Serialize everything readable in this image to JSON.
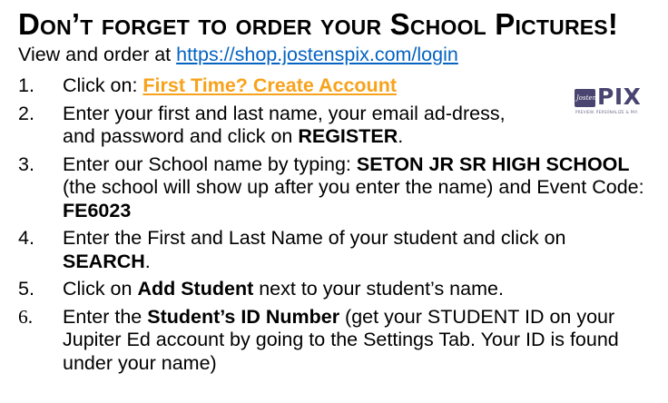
{
  "heading": "Don’t forget to order your School Pictures!",
  "subline": {
    "prefix": "View and order at ",
    "url": "https://shop.jostenspix.com/login"
  },
  "logo": {
    "script": "Jostens",
    "wordmark": "PIX",
    "tagline": "PREVIEW. PERSONALIZE & PAY.",
    "colors": {
      "brand": "#4a4570"
    }
  },
  "colors": {
    "link_blue": "#0563c1",
    "link_orange": "#f7a21b"
  },
  "steps": [
    {
      "num": "1.",
      "prefix": "Click on: ",
      "link": "First Time? Create Account"
    },
    {
      "num": "2.",
      "text": "Enter your first and last name, your email ad-dress, and password and click on ",
      "bold": "REGISTER",
      "suffix": "."
    },
    {
      "num": "3.",
      "text1": "Enter our School name by typing: ",
      "bold1": "SETON JR SR HIGH SCHOOL",
      "text2": " (the school will show up after you enter the name) and Event Code: ",
      "bold2": "FE6023"
    },
    {
      "num": "4.",
      "text": "Enter the First and Last Name of your student and click on ",
      "bold": "SEARCH",
      "suffix": "."
    },
    {
      "num": "5.",
      "text1": "Click on ",
      "bold": "Add Student",
      "text2": " next to your student’s name."
    },
    {
      "num": "6.",
      "text1": "Enter the ",
      "bold": "Student’s ID Number",
      "text2": " (get your STUDENT ID on your Jupiter Ed account by going to the Settings Tab. Your ID is found under your name)"
    }
  ]
}
